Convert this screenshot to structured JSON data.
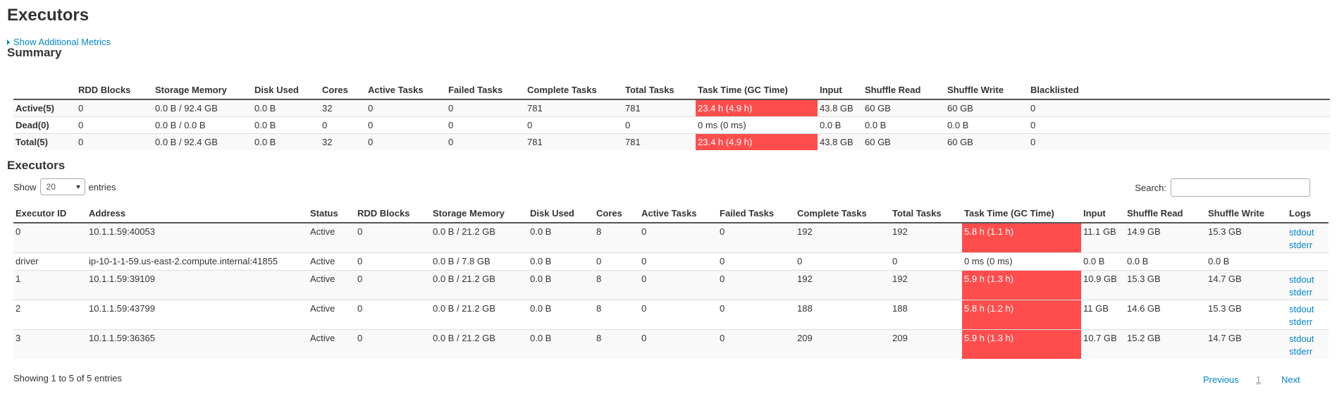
{
  "page": {
    "title": "Executors",
    "additional_metrics_label": "Show Additional Metrics",
    "summary_heading": "Summary",
    "executors_heading": "Executors"
  },
  "summary": {
    "columns": [
      "",
      "RDD Blocks",
      "Storage Memory",
      "Disk Used",
      "Cores",
      "Active Tasks",
      "Failed Tasks",
      "Complete Tasks",
      "Total Tasks",
      "Task Time (GC Time)",
      "Input",
      "Shuffle Read",
      "Shuffle Write",
      "Blacklisted"
    ],
    "rows": [
      [
        "Active(5)",
        "0",
        "0.0 B / 92.4 GB",
        "0.0 B",
        "32",
        "0",
        "0",
        "781",
        "781",
        "23.4 h (4.9 h)",
        "43.8 GB",
        "60 GB",
        "60 GB",
        "0"
      ],
      [
        "Dead(0)",
        "0",
        "0.0 B / 0.0 B",
        "0.0 B",
        "0",
        "0",
        "0",
        "0",
        "0",
        "0 ms (0 ms)",
        "0.0 B",
        "0.0 B",
        "0.0 B",
        "0"
      ],
      [
        "Total(5)",
        "0",
        "0.0 B / 92.4 GB",
        "0.0 B",
        "32",
        "0",
        "0",
        "781",
        "781",
        "23.4 h (4.9 h)",
        "43.8 GB",
        "60 GB",
        "60 GB",
        "0"
      ]
    ]
  },
  "controls": {
    "show_label": "Show",
    "page_length": "20",
    "entries_label": "entries",
    "search_label": "Search:",
    "search_value": ""
  },
  "executors": {
    "columns": [
      "Executor ID",
      "Address",
      "Status",
      "RDD Blocks",
      "Storage Memory",
      "Disk Used",
      "Cores",
      "Active Tasks",
      "Failed Tasks",
      "Complete Tasks",
      "Total Tasks",
      "Task Time (GC Time)",
      "Input",
      "Shuffle Read",
      "Shuffle Write",
      "Logs"
    ],
    "rows": [
      [
        "0",
        "10.1.1.59:40053",
        "Active",
        "0",
        "0.0 B / 21.2 GB",
        "0.0 B",
        "8",
        "0",
        "0",
        "192",
        "192",
        "5.8 h (1.1 h)",
        "11.1 GB",
        "14.9 GB",
        "15.3 GB"
      ],
      [
        "driver",
        "ip-10-1-1-59.us-east-2.compute.internal:41855",
        "Active",
        "0",
        "0.0 B / 7.8 GB",
        "0.0 B",
        "0",
        "0",
        "0",
        "0",
        "0",
        "0 ms (0 ms)",
        "0.0 B",
        "0.0 B",
        "0.0 B"
      ],
      [
        "1",
        "10.1.1.59:39109",
        "Active",
        "0",
        "0.0 B / 21.2 GB",
        "0.0 B",
        "8",
        "0",
        "0",
        "192",
        "192",
        "5.9 h (1.3 h)",
        "10.9 GB",
        "15.3 GB",
        "14.7 GB"
      ],
      [
        "2",
        "10.1.1.59:43799",
        "Active",
        "0",
        "0.0 B / 21.2 GB",
        "0.0 B",
        "8",
        "0",
        "0",
        "188",
        "188",
        "5.8 h (1.2 h)",
        "11 GB",
        "14.6 GB",
        "15.3 GB"
      ],
      [
        "3",
        "10.1.1.59:36365",
        "Active",
        "0",
        "0.0 B / 21.2 GB",
        "0.0 B",
        "8",
        "0",
        "0",
        "209",
        "209",
        "5.9 h (1.3 h)",
        "10.7 GB",
        "15.2 GB",
        "14.7 GB"
      ]
    ],
    "log_labels": {
      "stdout": "stdout",
      "stderr": "stderr"
    }
  },
  "footer": {
    "info": "Showing 1 to 5 of 5 entries",
    "previous_label": "Previous",
    "current_page": "1",
    "next_label": "Next"
  },
  "colors": {
    "link": "#0088cc",
    "task_time_highlight": "#ff4d4d"
  }
}
